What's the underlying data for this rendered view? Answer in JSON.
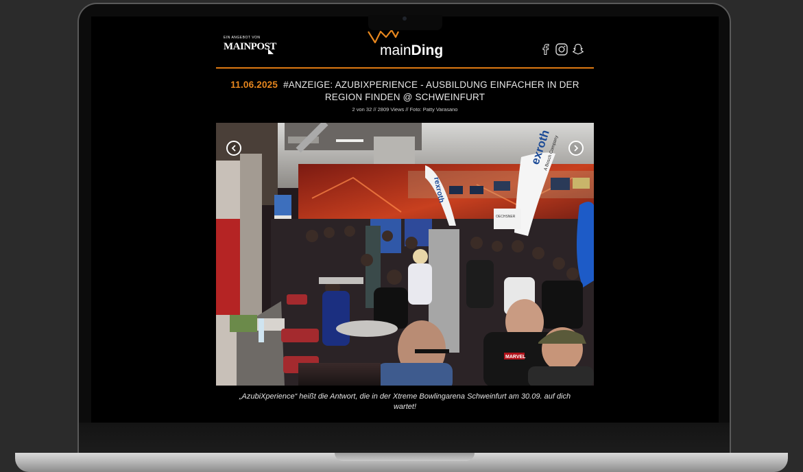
{
  "header": {
    "brand_small": "EIN ANGEBOT VON",
    "brand_big": "MAINPOST",
    "logo_thin": "main",
    "logo_bold": "Ding",
    "social": [
      "facebook-icon",
      "instagram-icon",
      "snapchat-icon"
    ]
  },
  "article": {
    "date": "11.06.2025",
    "title": "#ANZEIGE: AZUBIXPERIENCE - AUSBILDUNG EINFACHER IN DER REGION FINDEN @ SCHWEINFURT",
    "meta": "2 von 32 //  2809 Views // Foto: Patty Varasano",
    "caption": "„AzubiXperience“ heißt die Antwort, die in der Xtreme Bowlingarena Schweinfurt am 30.09. auf dich wartet!"
  },
  "photo": {
    "banner_1": "rexroth",
    "banner_2": "exroth",
    "banner_2_sub": "A Bosch Company",
    "stand_sign": "OECHSNER",
    "tshirt_print": "MARVEL"
  },
  "colors": {
    "accent": "#e8871e",
    "background": "#000000",
    "bezel": "#0c0c0c"
  }
}
